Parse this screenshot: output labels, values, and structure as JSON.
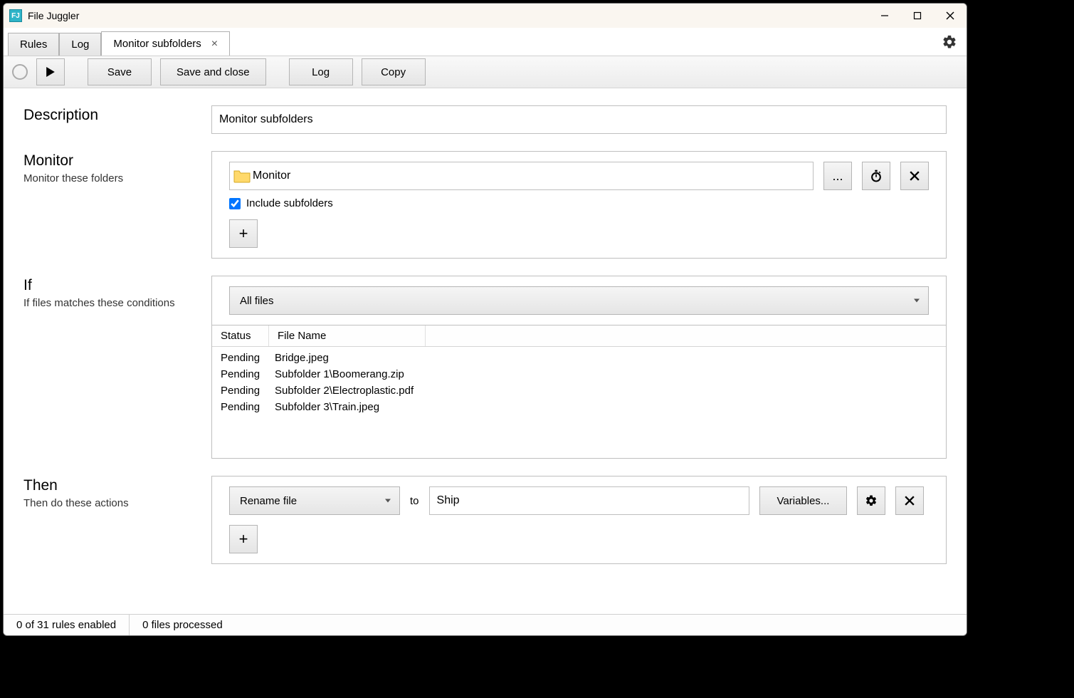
{
  "titlebar": {
    "app_name": "File Juggler"
  },
  "tabs": {
    "rules": "Rules",
    "log": "Log",
    "monitor": "Monitor subfolders"
  },
  "toolbar": {
    "save": "Save",
    "save_close": "Save and close",
    "log": "Log",
    "copy": "Copy"
  },
  "description": {
    "label": "Description",
    "value": "Monitor subfolders"
  },
  "monitor": {
    "label": "Monitor",
    "sub": "Monitor these folders",
    "folder_value": "Monitor",
    "browse": "...",
    "include_subfolders_label": "Include subfolders",
    "include_subfolders_checked": true,
    "add": "+"
  },
  "if_section": {
    "label": "If",
    "sub": "If files matches these conditions",
    "combo_value": "All files",
    "columns": {
      "status": "Status",
      "filename": "File Name"
    },
    "rows": [
      {
        "status": "Pending",
        "filename": "Bridge.jpeg"
      },
      {
        "status": "Pending",
        "filename": "Subfolder 1\\Boomerang.zip"
      },
      {
        "status": "Pending",
        "filename": "Subfolder 2\\Electroplastic.pdf"
      },
      {
        "status": "Pending",
        "filename": "Subfolder 3\\Train.jpeg"
      }
    ]
  },
  "then_section": {
    "label": "Then",
    "sub": "Then do these actions",
    "combo_value": "Rename file",
    "to_label": "to",
    "to_value": "Ship",
    "variables": "Variables...",
    "add": "+"
  },
  "statusbar": {
    "rules_enabled": "0 of 31 rules enabled",
    "files_processed": "0 files processed"
  }
}
